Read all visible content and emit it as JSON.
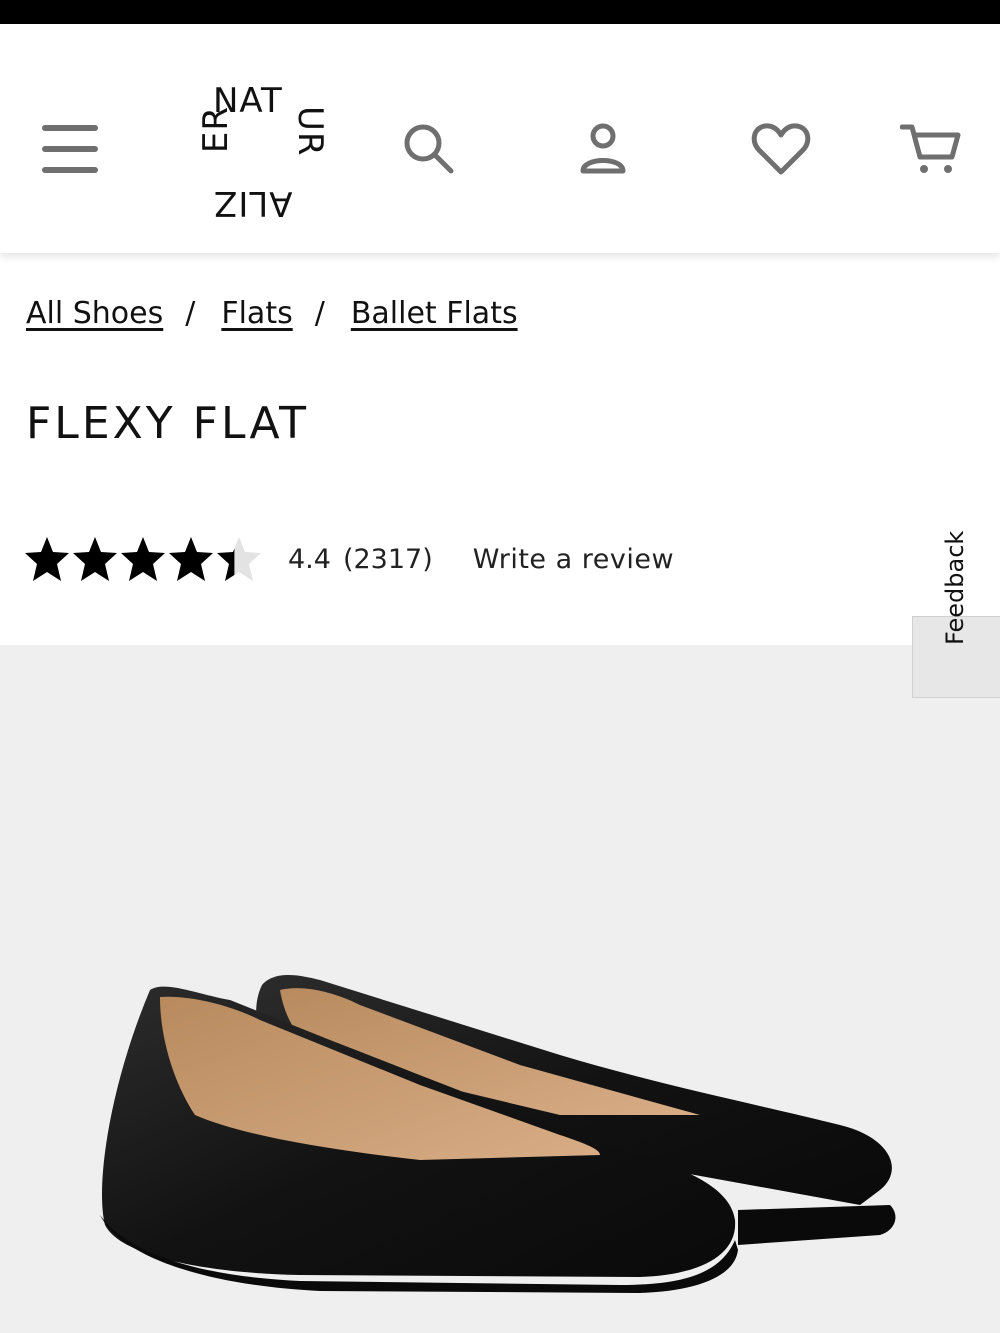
{
  "brand": {
    "logo_top": "NAT",
    "logo_left": "ER",
    "logo_right": "UR",
    "logo_bottom": "ALIZ"
  },
  "header": {
    "icons": [
      "menu-icon",
      "search-icon",
      "account-icon",
      "heart-icon",
      "cart-icon"
    ]
  },
  "breadcrumb": [
    {
      "label": "All Shoes"
    },
    {
      "label": "Flats"
    },
    {
      "label": "Ballet Flats"
    }
  ],
  "breadcrumb_separator": "/",
  "product": {
    "title": "FLEXY FLAT",
    "rating_value": "4.4",
    "rating_count": "(2317)",
    "rating_fraction": 0.88,
    "write_review_label": "Write a review"
  },
  "feedback_tab": {
    "label": "Feedback"
  },
  "colors": {
    "icon_gray": "#6f6f6f",
    "text": "#111111",
    "product_bg": "#efefef"
  }
}
